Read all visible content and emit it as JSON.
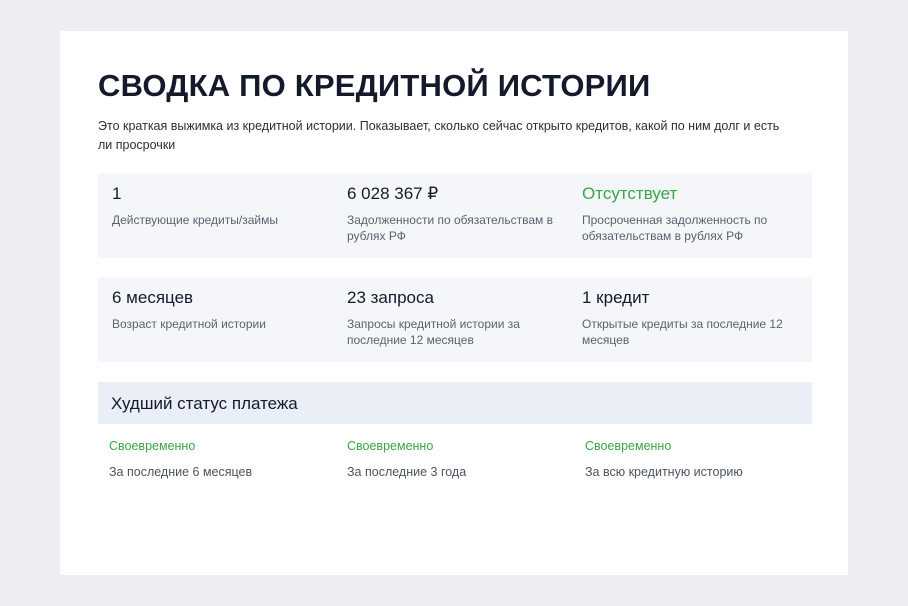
{
  "summary": {
    "title": "СВОДКА ПО КРЕДИТНОЙ ИСТОРИИ",
    "subtitle": "Это краткая выжимка из кредитной истории. Показывает, сколько сейчас открыто кредитов, какой по ним долг и есть ли просрочки",
    "stats_row1": [
      {
        "value": "1",
        "label": "Действующие кредиты/займы"
      },
      {
        "value": "6 028 367 ₽",
        "label": "Задолженности по обязательствам в рублях РФ"
      },
      {
        "value": "Отсутствует",
        "label": "Просроченная задолженность по обязательствам в рублях РФ",
        "color": "#3aa548"
      }
    ],
    "stats_row2": [
      {
        "value": "6 месяцев",
        "label": "Возраст кредитной истории"
      },
      {
        "value": "23 запроса",
        "label": "Запросы кредитной истории за последние 12 месяцев"
      },
      {
        "value": "1 кредит",
        "label": "Открытые кредиты за последние 12 месяцев"
      }
    ],
    "worst_status": {
      "title": "Худший статус платежа",
      "periods": [
        {
          "status": "Своевременно",
          "label": "За последние 6 месяцев"
        },
        {
          "status": "Своевременно",
          "label": "За последние 3 года"
        },
        {
          "status": "Своевременно",
          "label": "За всю кредитную историю"
        }
      ]
    }
  },
  "colors": {
    "background": "#eceef1",
    "card": "#ffffff",
    "stats_panel": "#f4f6fa",
    "worst_header": "#eaeef7",
    "success": "#3aa548",
    "text": "#141a2b"
  }
}
